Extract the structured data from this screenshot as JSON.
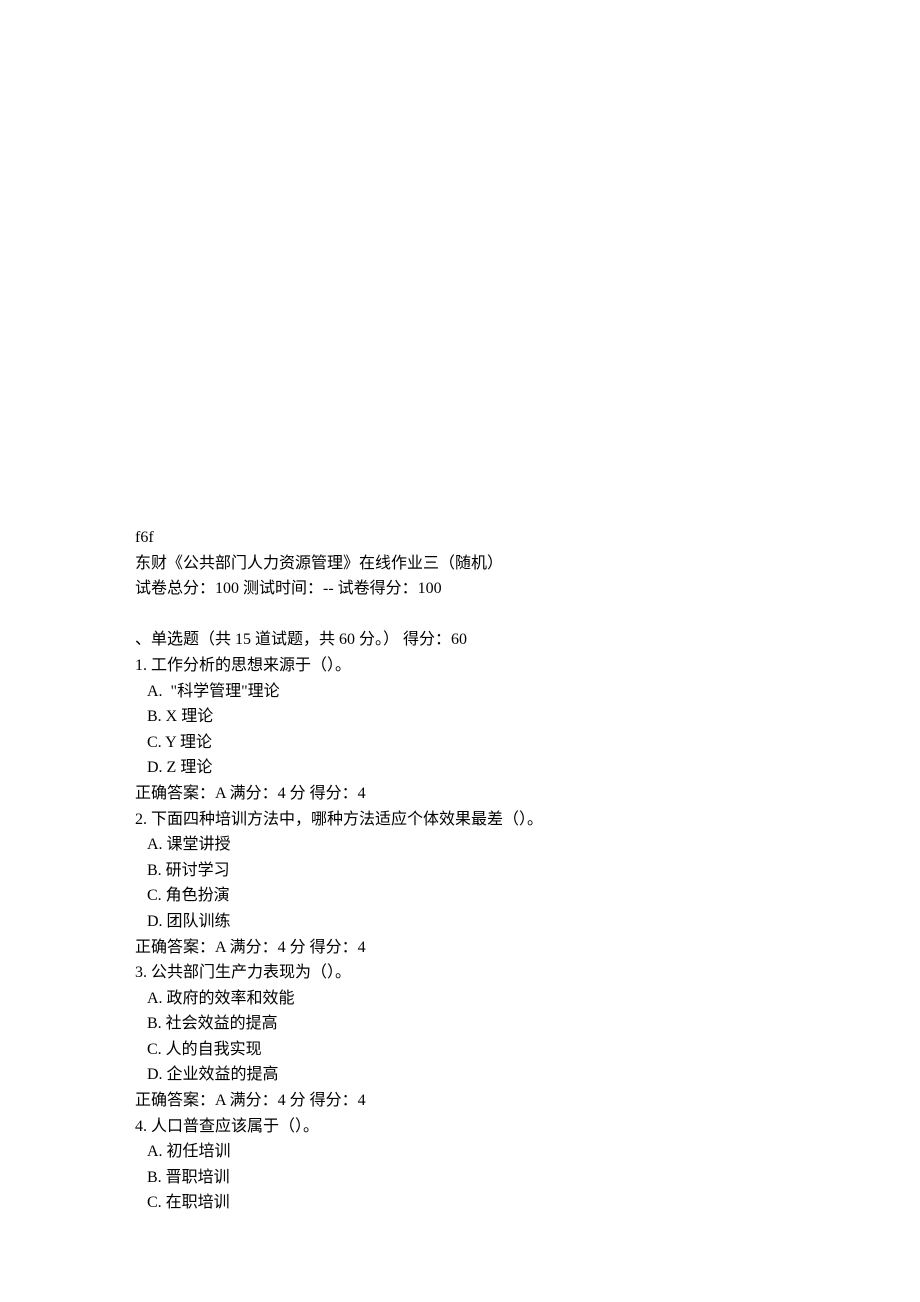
{
  "header": {
    "code": "f6f",
    "title": "东财《公共部门人力资源管理》在线作业三（随机）",
    "meta": "试卷总分：100 测试时间：-- 试卷得分：100"
  },
  "section": {
    "title": "、单选题（共 15 道试题，共 60 分。） 得分：60"
  },
  "questions": [
    {
      "stem": "1. 工作分析的思想来源于（）。",
      "options": [
        " A.  \"科学管理\"理论",
        " B. X 理论",
        " C. Y 理论",
        " D. Z 理论"
      ],
      "answer": "正确答案：A 满分：4 分 得分：4"
    },
    {
      "stem": "2. 下面四种培训方法中，哪种方法适应个体效果最差（）。",
      "options": [
        " A. 课堂讲授",
        " B. 研讨学习",
        " C. 角色扮演",
        " D. 团队训练"
      ],
      "answer": "正确答案：A 满分：4 分 得分：4"
    },
    {
      "stem": "3. 公共部门生产力表现为（）。",
      "options": [
        " A. 政府的效率和效能",
        " B. 社会效益的提高",
        " C. 人的自我实现",
        " D. 企业效益的提高"
      ],
      "answer": "正确答案：A 满分：4 分 得分：4"
    },
    {
      "stem": "4. 人口普查应该属于（）。",
      "options": [
        " A. 初任培训",
        " B. 晋职培训",
        " C. 在职培训"
      ]
    }
  ]
}
